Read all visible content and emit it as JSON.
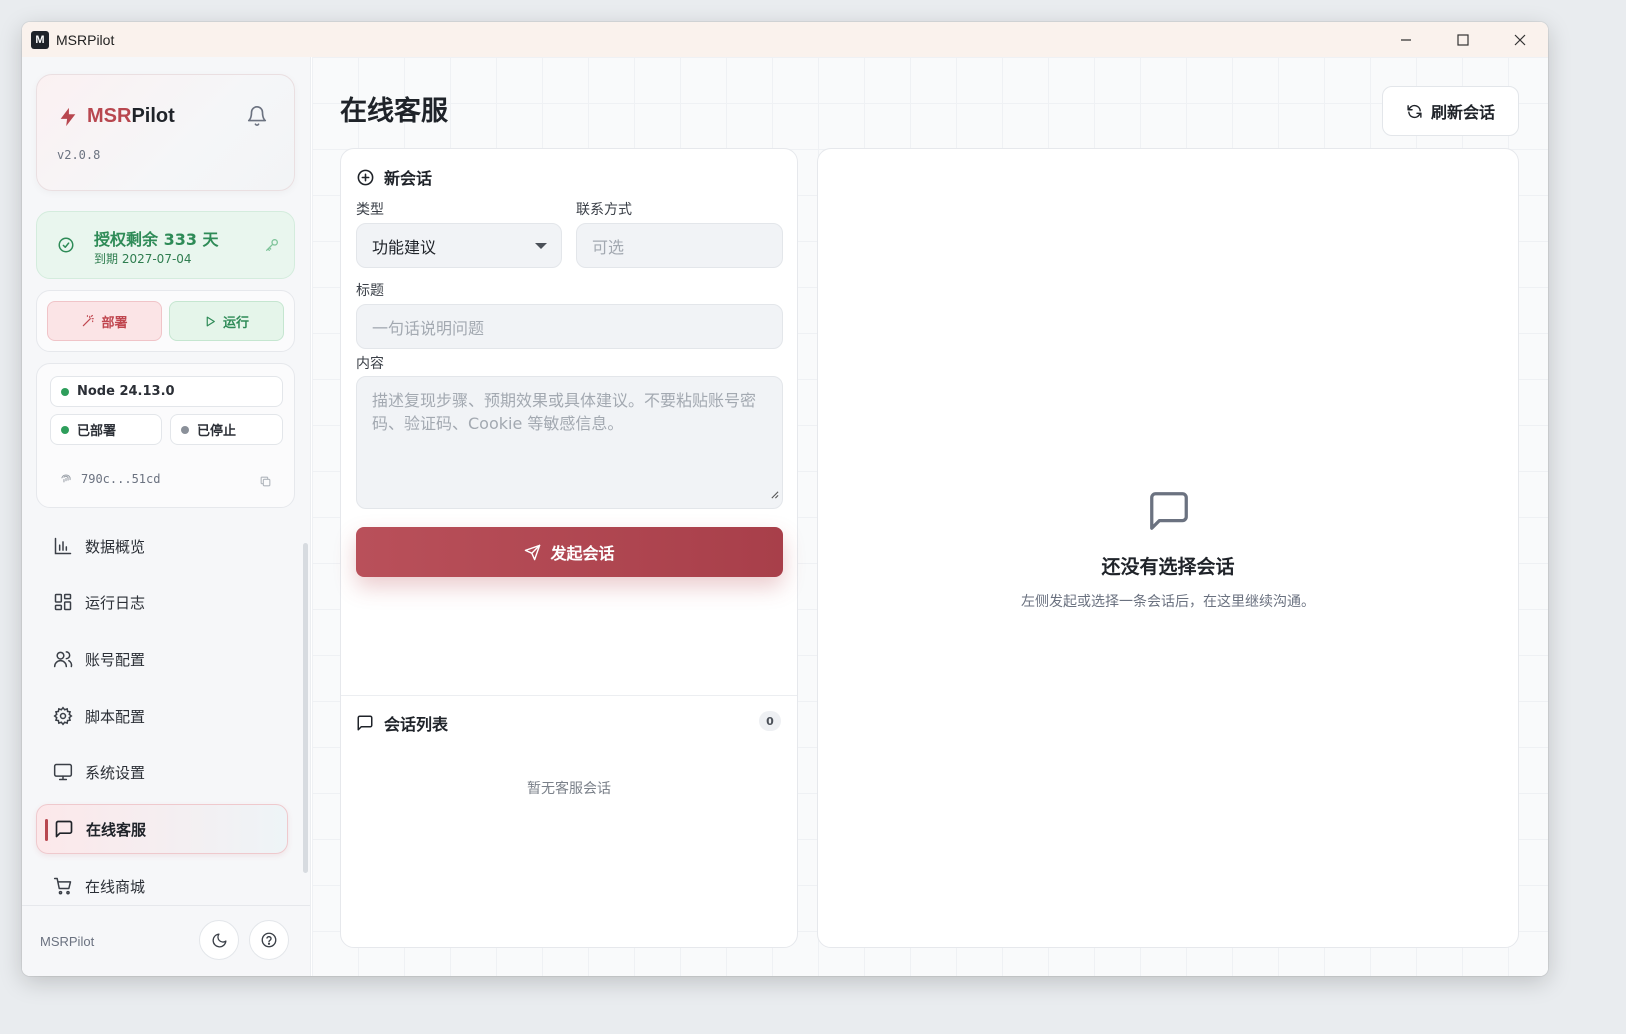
{
  "window": {
    "title": "MSRPilot",
    "app_icon_letter": "M"
  },
  "sidebar": {
    "brand": {
      "name_accent": "MSR",
      "name_rest": "Pilot",
      "version": "v2.0.8"
    },
    "license": {
      "title": "授权剩余 333 天",
      "expiry": "到期 2027-07-04"
    },
    "actions": {
      "deploy_label": "部署",
      "run_label": "运行"
    },
    "status": {
      "node": "Node 24.13.0",
      "deployed": "已部署",
      "stopped": "已停止",
      "fingerprint": "790c...51cd"
    },
    "nav": [
      {
        "label": "数据概览",
        "icon": "bar-chart-icon"
      },
      {
        "label": "运行日志",
        "icon": "dashboard-grid-icon"
      },
      {
        "label": "账号配置",
        "icon": "users-icon"
      },
      {
        "label": "脚本配置",
        "icon": "gear-icon"
      },
      {
        "label": "系统设置",
        "icon": "monitor-icon"
      },
      {
        "label": "在线客服",
        "icon": "message-square-icon",
        "active": true
      },
      {
        "label": "在线商城",
        "icon": "shopping-cart-icon"
      }
    ],
    "footer": {
      "name": "MSRPilot"
    }
  },
  "main": {
    "title": "在线客服",
    "refresh_label": "刷新会话",
    "new_session": {
      "heading": "新会话",
      "type_label": "类型",
      "type_value": "功能建议",
      "contact_label": "联系方式",
      "contact_placeholder": "可选",
      "subject_label": "标题",
      "subject_placeholder": "一句话说明问题",
      "content_label": "内容",
      "content_placeholder": "描述复现步骤、预期效果或具体建议。不要粘贴账号密码、验证码、Cookie 等敏感信息。",
      "submit_label": "发起会话"
    },
    "session_list": {
      "heading": "会话列表",
      "count": "0",
      "empty_text": "暂无客服会话"
    },
    "detail": {
      "empty_title": "还没有选择会话",
      "empty_sub": "左侧发起或选择一条会话后，在这里继续沟通。"
    }
  },
  "colors": {
    "accent": "#b8474f",
    "success": "#2e8b57",
    "muted": "#6b7280"
  }
}
